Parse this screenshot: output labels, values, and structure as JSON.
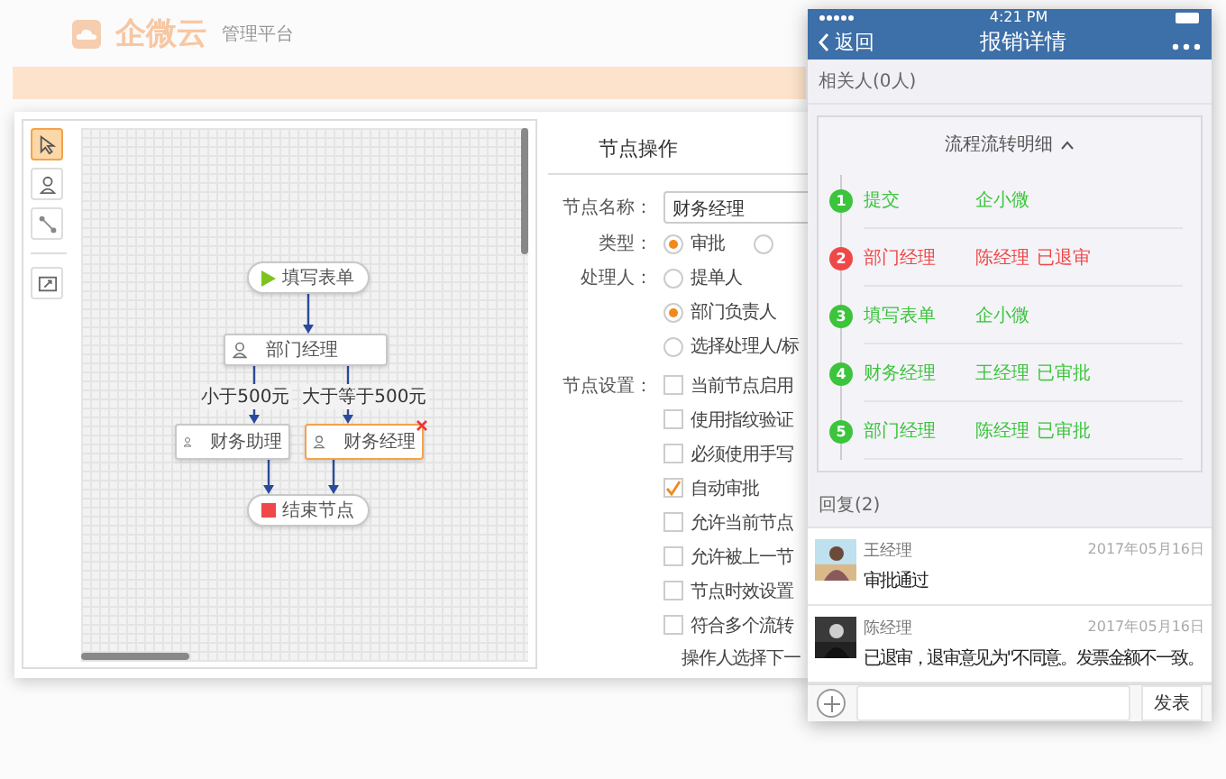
{
  "background": {
    "logo": "企微云",
    "subtitle": "管理平台"
  },
  "toolbox": [
    {
      "kind": "pointer",
      "selected": true
    },
    {
      "kind": "person",
      "selected": false
    },
    {
      "kind": "connector",
      "selected": false
    },
    {
      "kind": "export",
      "selected": false
    }
  ],
  "flow": {
    "nodes": [
      {
        "kind": "start",
        "label": "填写表单",
        "selected": false
      },
      {
        "kind": "task",
        "label": "部门经理",
        "selected": false
      },
      {
        "kind": "task",
        "label": "财务助理",
        "selected": false
      },
      {
        "kind": "task",
        "label": "财务经理",
        "selected": true
      },
      {
        "kind": "end",
        "label": "结束节点",
        "selected": false
      }
    ],
    "conditions": [
      "小于500元",
      "大于等于500元"
    ]
  },
  "form": {
    "title": "节点操作",
    "name_label": "节点名称：",
    "name_value": "财务经理",
    "type_label": "类型：",
    "type_options": [
      {
        "label": "审批",
        "selected": true
      },
      {
        "selected": false
      }
    ],
    "handler_label": "处理人：",
    "handler_options": [
      {
        "label": "提单人",
        "selected": false
      },
      {
        "label": "部门负责人",
        "selected": true
      },
      {
        "label": "选择处理人/标",
        "selected": false
      }
    ],
    "settings_label": "节点设置：",
    "settings": [
      {
        "label": "当前节点启用",
        "checked": false
      },
      {
        "label": "使用指纹验证",
        "checked": false
      },
      {
        "label": "必须使用手写",
        "checked": false
      },
      {
        "label": "自动审批",
        "checked": true
      },
      {
        "label": "允许当前节点",
        "checked": false
      },
      {
        "label": "允许被上一节",
        "checked": false
      },
      {
        "label": "节点时效设置",
        "checked": false
      },
      {
        "label": "符合多个流转",
        "checked": false
      }
    ],
    "footer": "操作人选择下一"
  },
  "phone": {
    "time": "4:21 PM",
    "back": "返回",
    "title": "报销详情",
    "related": "相关人(0人)",
    "flow_title": "流程流转明细",
    "steps": [
      {
        "number": "1",
        "name": "提交",
        "person": "企小微",
        "color": "#3cc43c"
      },
      {
        "number": "2",
        "name": "部门经理",
        "person": "陈经理",
        "result": "已退审",
        "color": "#f04848"
      },
      {
        "number": "3",
        "name": "填写表单",
        "person": "企小微",
        "color": "#3cc43c"
      },
      {
        "number": "4",
        "name": "财务经理",
        "person": "王经理",
        "result": "已审批",
        "color": "#3cc43c"
      },
      {
        "number": "5",
        "name": "部门经理",
        "person": "陈经理",
        "result": "已审批",
        "color": "#3cc43c"
      }
    ],
    "replies_title": "回复(2)",
    "replies": [
      {
        "name": "王经理",
        "date": "2017年05月16日",
        "text": "审批通过"
      },
      {
        "name": "陈经理",
        "date": "2017年05月16日",
        "text": "已退审，退审意见为\"不同意。发票金额不一致。"
      }
    ],
    "send": "发表"
  }
}
